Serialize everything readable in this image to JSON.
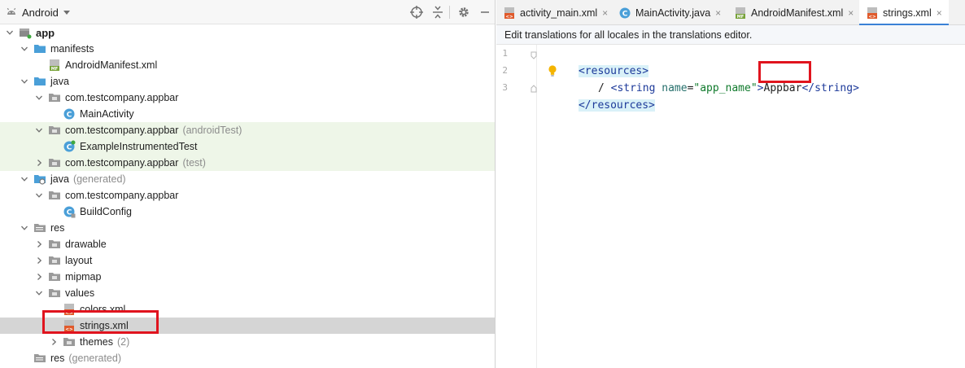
{
  "project_panel": {
    "view_selector": "Android",
    "header_icons": [
      "crosshair-icon",
      "collapse-icon",
      "gear-icon",
      "minimize-icon"
    ],
    "tree": [
      {
        "label": "app",
        "suffix": "",
        "depth": 0,
        "arrow": "down",
        "icon": "module-icon",
        "bold": true
      },
      {
        "label": "manifests",
        "suffix": "",
        "depth": 1,
        "arrow": "down",
        "icon": "folder-icon"
      },
      {
        "label": "AndroidManifest.xml",
        "suffix": "",
        "depth": 2,
        "arrow": "none",
        "icon": "manifest-file-icon"
      },
      {
        "label": "java",
        "suffix": "",
        "depth": 1,
        "arrow": "down",
        "icon": "folder-icon"
      },
      {
        "label": "com.testcompany.appbar",
        "suffix": "",
        "depth": 2,
        "arrow": "down",
        "icon": "package-icon"
      },
      {
        "label": "MainActivity",
        "suffix": "",
        "depth": 3,
        "arrow": "none",
        "icon": "class-icon"
      },
      {
        "label": "com.testcompany.appbar",
        "suffix": "(androidTest)",
        "depth": 2,
        "arrow": "down",
        "icon": "package-icon",
        "tint": true
      },
      {
        "label": "ExampleInstrumentedTest",
        "suffix": "",
        "depth": 3,
        "arrow": "none",
        "icon": "test-class-icon",
        "tint": true
      },
      {
        "label": "com.testcompany.appbar",
        "suffix": "(test)",
        "depth": 2,
        "arrow": "right",
        "icon": "package-icon",
        "tint": true
      },
      {
        "label": "java",
        "suffix": "(generated)",
        "depth": 1,
        "arrow": "down",
        "icon": "generated-folder-icon"
      },
      {
        "label": "com.testcompany.appbar",
        "suffix": "",
        "depth": 2,
        "arrow": "down",
        "icon": "package-icon"
      },
      {
        "label": "BuildConfig",
        "suffix": "",
        "depth": 3,
        "arrow": "none",
        "icon": "class-locked-icon"
      },
      {
        "label": "res",
        "suffix": "",
        "depth": 1,
        "arrow": "down",
        "icon": "res-folder-icon"
      },
      {
        "label": "drawable",
        "suffix": "",
        "depth": 2,
        "arrow": "right",
        "icon": "package-icon"
      },
      {
        "label": "layout",
        "suffix": "",
        "depth": 2,
        "arrow": "right",
        "icon": "package-icon"
      },
      {
        "label": "mipmap",
        "suffix": "",
        "depth": 2,
        "arrow": "right",
        "icon": "package-icon"
      },
      {
        "label": "values",
        "suffix": "",
        "depth": 2,
        "arrow": "down",
        "icon": "package-icon"
      },
      {
        "label": "colors.xml",
        "suffix": "",
        "depth": 3,
        "arrow": "none",
        "icon": "xml-file-icon"
      },
      {
        "label": "strings.xml",
        "suffix": "",
        "depth": 3,
        "arrow": "none",
        "icon": "xml-file-icon",
        "selected": true,
        "boxed": true
      },
      {
        "label": "themes",
        "suffix": "(2)",
        "depth": 3,
        "arrow": "right",
        "icon": "package-icon"
      },
      {
        "label": "res",
        "suffix": "(generated)",
        "depth": 1,
        "arrow": "none",
        "icon": "res-folder-icon"
      }
    ]
  },
  "editor": {
    "tabs": [
      {
        "label": "activity_main.xml",
        "icon": "xml-file-icon",
        "active": false
      },
      {
        "label": "MainActivity.java",
        "icon": "class-icon",
        "active": false
      },
      {
        "label": "AndroidManifest.xml",
        "icon": "manifest-file-icon",
        "active": false
      },
      {
        "label": "strings.xml",
        "icon": "xml-file-icon",
        "active": true
      }
    ],
    "close_glyph": "×",
    "banner": "Edit translations for all locales in the translations editor.",
    "line_numbers": [
      "1",
      "2",
      "3"
    ],
    "code": {
      "open_tag": "<resources>",
      "string_open": "<string",
      "attr_name": "name",
      "attr_eq": "=",
      "attr_value": "\"app_name\"",
      "gt": ">",
      "string_value": "Appbar",
      "string_close": "</string>",
      "close_tag": "</resources>"
    }
  },
  "colors": {
    "highlight_box": "#e0141e",
    "tint_row": "#eef6e8",
    "selected_row": "#d5d5d5",
    "active_tab_indicator": "#3b82d6"
  }
}
